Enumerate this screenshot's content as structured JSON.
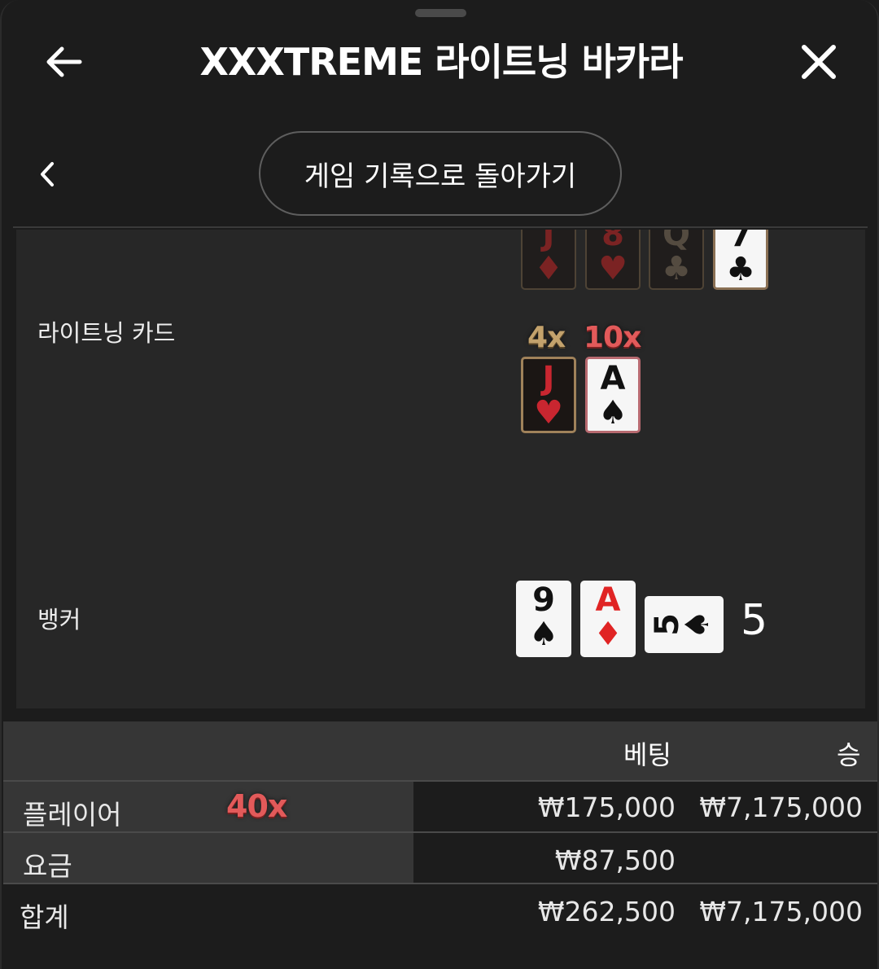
{
  "header": {
    "title": "XXXTREME 라이트닝 바카라"
  },
  "subnav": {
    "back_history_label": "게임 기록으로 돌아가기"
  },
  "player_cards_partial": [
    {
      "rank": "J",
      "suit": "♦",
      "color": "red"
    },
    {
      "rank": "8",
      "suit": "♥",
      "color": "red"
    },
    {
      "rank": "Q",
      "suit": "♣",
      "color": "black"
    },
    {
      "rank": "7",
      "suit": "♣",
      "color": "black"
    }
  ],
  "lightning": {
    "label": "라이트닝 카드",
    "cards": [
      {
        "multiplier": "4x",
        "rank": "J",
        "suit": "♥",
        "color": "red"
      },
      {
        "multiplier": "10x",
        "rank": "A",
        "suit": "♠",
        "color": "black"
      }
    ]
  },
  "banker": {
    "label": "뱅커",
    "cards": [
      {
        "rank": "9",
        "suit": "♠",
        "color": "black"
      },
      {
        "rank": "A",
        "suit": "♦",
        "color": "red"
      },
      {
        "rank": "5",
        "suit": "♠",
        "color": "black"
      }
    ],
    "score": "5"
  },
  "bets_table": {
    "headers": {
      "bet": "베팅",
      "win": "승"
    },
    "rows": [
      {
        "name": "플레이어",
        "multiplier": "40x",
        "bet": "₩175,000",
        "win": "₩7,175,000"
      },
      {
        "name": "요금",
        "multiplier": "",
        "bet": "₩87,500",
        "win": ""
      },
      {
        "name": "합계",
        "multiplier": "",
        "bet": "₩262,500",
        "win": "₩7,175,000"
      }
    ]
  },
  "colors": {
    "background": "#1c1c1c",
    "result_area": "#272727",
    "table_header": "#363636",
    "multiplier_gold": "#c3a26c",
    "multiplier_red": "#e25a5a"
  }
}
